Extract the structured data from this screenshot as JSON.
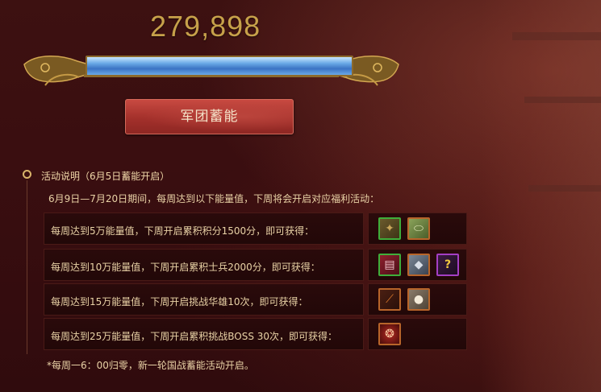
{
  "score": "279,898",
  "progress": {
    "fill_fraction": 1.0
  },
  "action_button": {
    "label": "军团蓄能"
  },
  "info": {
    "title": "活动说明（6月5日蓄能开启）",
    "period": "6月9日—7月20日期间，每周达到以下能量值，下周将会开启对应福利活动：",
    "rows": [
      {
        "text": "每周达到5万能量值，下周开启累积积分1500分，即可获得：",
        "items": [
          {
            "icon": "bronze-ore-icon",
            "rarity": "green"
          },
          {
            "icon": "cucumber-icon",
            "rarity": "orange"
          }
        ]
      },
      {
        "text": "每周达到10万能量值，下周开启累积士兵2000分，即可获得：",
        "items": [
          {
            "icon": "skill-book-icon",
            "rarity": "green"
          },
          {
            "icon": "iron-ore-icon",
            "rarity": "orange"
          },
          {
            "icon": "mystery-box-icon",
            "rarity": "purple"
          }
        ]
      },
      {
        "text": "每周达到15万能量值，下周开启挑战华雄10次，即可获得：",
        "items": [
          {
            "icon": "dagger-icon",
            "rarity": "orange"
          },
          {
            "icon": "steamed-bun-icon",
            "rarity": "orange"
          }
        ]
      },
      {
        "text": "每周达到25万能量值，下周开启累积挑战BOSS 30次，即可获得：",
        "items": [
          {
            "icon": "red-pouch-icon",
            "rarity": "orange"
          }
        ]
      }
    ],
    "footnote": "*每周一6：00归零，新一轮国战蓄能活动开启。"
  }
}
